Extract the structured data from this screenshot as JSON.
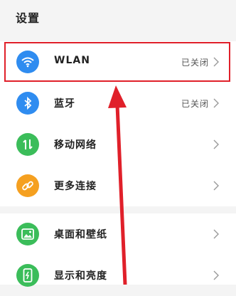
{
  "header": {
    "title": "设置"
  },
  "settings": {
    "items": [
      {
        "label": "WLAN",
        "value": "已关闭",
        "icon": "wifi-icon",
        "color": "#2f8cf0"
      },
      {
        "label": "蓝牙",
        "value": "已关闭",
        "icon": "bluetooth-icon",
        "color": "#2f8cf0"
      },
      {
        "label": "移动网络",
        "value": "",
        "icon": "mobile-data-icon",
        "color": "#3bbd5a"
      },
      {
        "label": "更多连接",
        "value": "",
        "icon": "link-icon",
        "color": "#f5a020"
      },
      {
        "label": "桌面和壁纸",
        "value": "",
        "icon": "wallpaper-icon",
        "color": "#3bbd5a"
      },
      {
        "label": "显示和亮度",
        "value": "",
        "icon": "display-brightness-icon",
        "color": "#3bbd5a"
      }
    ]
  },
  "annotation": {
    "color": "#e0202a"
  }
}
